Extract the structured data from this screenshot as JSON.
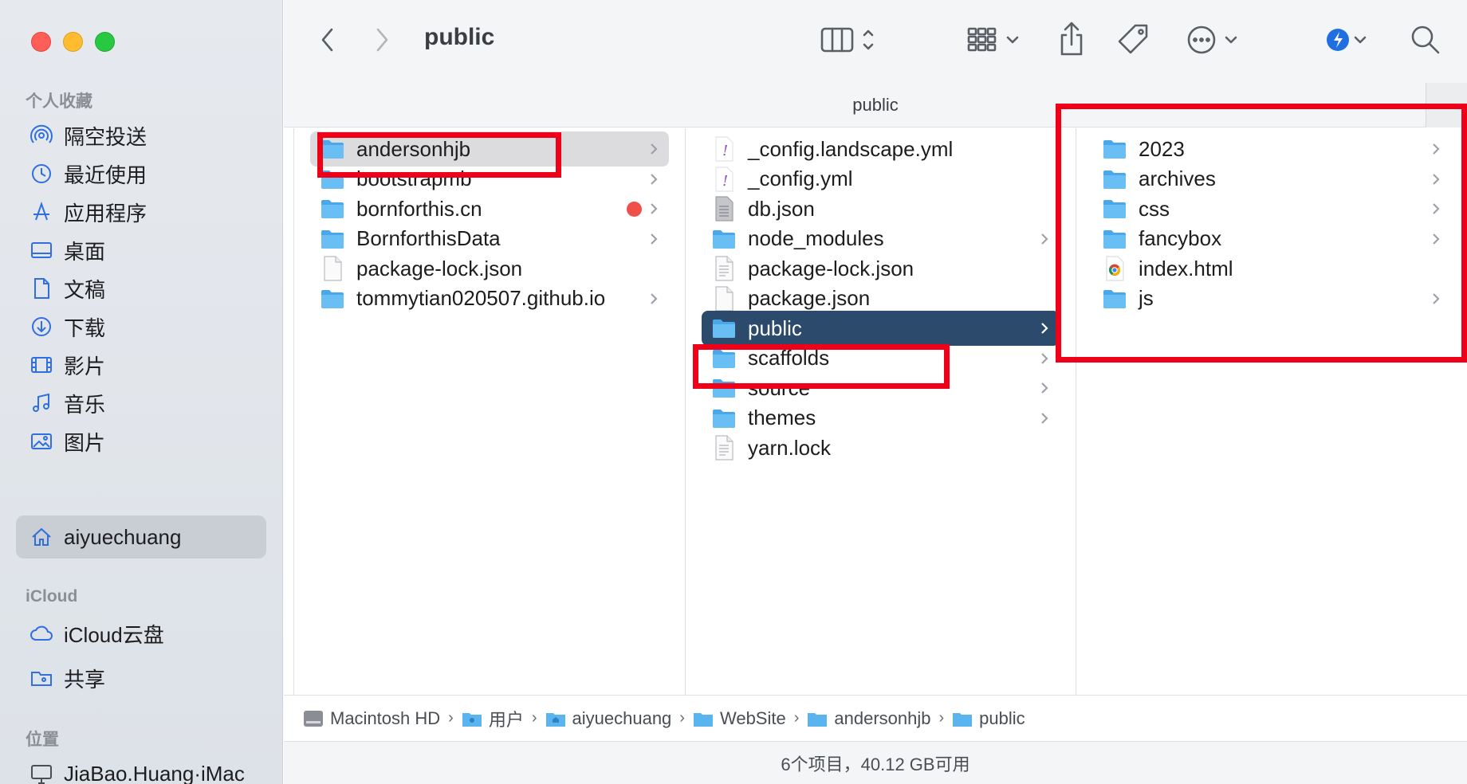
{
  "window": {
    "title": "public"
  },
  "sidebar": {
    "sections": {
      "favorites": "个人收藏",
      "icloud": "iCloud",
      "locations": "位置"
    },
    "favorites": [
      {
        "label": "隔空投送",
        "icon": "airdrop-icon"
      },
      {
        "label": "最近使用",
        "icon": "clock-icon"
      },
      {
        "label": "应用程序",
        "icon": "applications-icon"
      },
      {
        "label": "桌面",
        "icon": "desktop-icon"
      },
      {
        "label": "文稿",
        "icon": "document-icon"
      },
      {
        "label": "下载",
        "icon": "download-icon"
      },
      {
        "label": "影片",
        "icon": "film-icon"
      },
      {
        "label": "音乐",
        "icon": "music-icon"
      },
      {
        "label": "图片",
        "icon": "photo-icon"
      },
      {
        "label": "aiyuechuang",
        "icon": "home-icon",
        "selected": true
      }
    ],
    "icloud": [
      {
        "label": "iCloud云盘",
        "icon": "cloud-icon"
      },
      {
        "label": "共享",
        "icon": "shared-folder-icon"
      }
    ],
    "locations": [
      {
        "label": "JiaBao.Huang·iMac",
        "icon": "computer-icon"
      }
    ]
  },
  "path_header": "public",
  "columns": {
    "col1": [
      {
        "name": "andersonhjb",
        "kind": "folder",
        "chevron": true,
        "selected": "gray"
      },
      {
        "name": "bootstrapmb",
        "kind": "folder",
        "chevron": true
      },
      {
        "name": "bornforthis.cn",
        "kind": "folder",
        "chevron": true,
        "tag_color": "#f0504a"
      },
      {
        "name": "BornforthisData",
        "kind": "folder",
        "chevron": true
      },
      {
        "name": "package-lock.json",
        "kind": "file"
      },
      {
        "name": "tommytian020507.github.io",
        "kind": "folder",
        "chevron": true
      }
    ],
    "col2": [
      {
        "name": "_config.landscape.yml",
        "kind": "yml"
      },
      {
        "name": "_config.yml",
        "kind": "yml"
      },
      {
        "name": "db.json",
        "kind": "json"
      },
      {
        "name": "node_modules",
        "kind": "folder",
        "chevron": true
      },
      {
        "name": "package-lock.json",
        "kind": "textfile"
      },
      {
        "name": "package.json",
        "kind": "file"
      },
      {
        "name": "public",
        "kind": "folder",
        "chevron": true,
        "selected": "blue"
      },
      {
        "name": "scaffolds",
        "kind": "folder",
        "chevron": true
      },
      {
        "name": "source",
        "kind": "folder",
        "chevron": true
      },
      {
        "name": "themes",
        "kind": "folder",
        "chevron": true
      },
      {
        "name": "yarn.lock",
        "kind": "textfile"
      }
    ],
    "col3": [
      {
        "name": "2023",
        "kind": "folder",
        "chevron": true
      },
      {
        "name": "archives",
        "kind": "folder",
        "chevron": true
      },
      {
        "name": "css",
        "kind": "folder",
        "chevron": true
      },
      {
        "name": "fancybox",
        "kind": "folder",
        "chevron": true
      },
      {
        "name": "index.html",
        "kind": "html"
      },
      {
        "name": "js",
        "kind": "folder",
        "chevron": true
      }
    ]
  },
  "pathbar": [
    {
      "label": "Macintosh HD",
      "icon": "disk-icon"
    },
    {
      "label": "用户",
      "icon": "users-folder-icon"
    },
    {
      "label": "aiyuechuang",
      "icon": "home-folder-icon"
    },
    {
      "label": "WebSite",
      "icon": "folder-icon"
    },
    {
      "label": "andersonhjb",
      "icon": "folder-icon"
    },
    {
      "label": "public",
      "icon": "folder-icon"
    }
  ],
  "status": "6个项目，40.12 GB可用",
  "colors": {
    "folder": "#5ab4ef",
    "selection_blue": "#2c4b6c",
    "annotation_red": "#f00018",
    "accent": "#2f6fe0"
  }
}
